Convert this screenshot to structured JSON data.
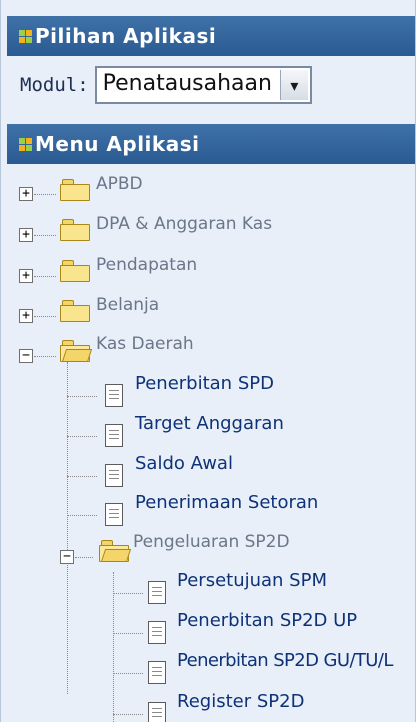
{
  "pilihan_panel": {
    "title": "Pilihan Aplikasi",
    "modul_label": "Modul:",
    "modul_selected": "Penatausahaan"
  },
  "menu_panel": {
    "title": "Menu Aplikasi"
  },
  "tree": {
    "apbd": "APBD",
    "dpa": "DPA & Anggaran Kas",
    "pendapatan": "Pendapatan",
    "belanja": "Belanja",
    "kas_daerah": "Kas Daerah",
    "kas_children": {
      "penerbitan_spd": "Penerbitan SPD",
      "target_anggaran": "Target Anggaran",
      "saldo_awal": "Saldo Awal",
      "penerimaan_setoran": "Penerimaan Setoran",
      "pengeluaran_sp2d": "Pengeluaran SP2D"
    },
    "sp2d_children": {
      "persetujuan_spm": "Persetujuan SPM",
      "penerbitan_sp2d_up": "Penerbitan SP2D UP",
      "penerbitan_sp2d_gu": "Penerbitan SP2D GU/TU/L",
      "register_sp2d": "Register SP2D"
    }
  },
  "icons": {
    "expand": "+",
    "collapse": "−",
    "dropdown": "▾"
  },
  "colors": {
    "header_bg": "#2f6298",
    "panel_bg": "#e9eff8",
    "leaf_text": "#0d3278",
    "folder_text": "#6a7689"
  }
}
